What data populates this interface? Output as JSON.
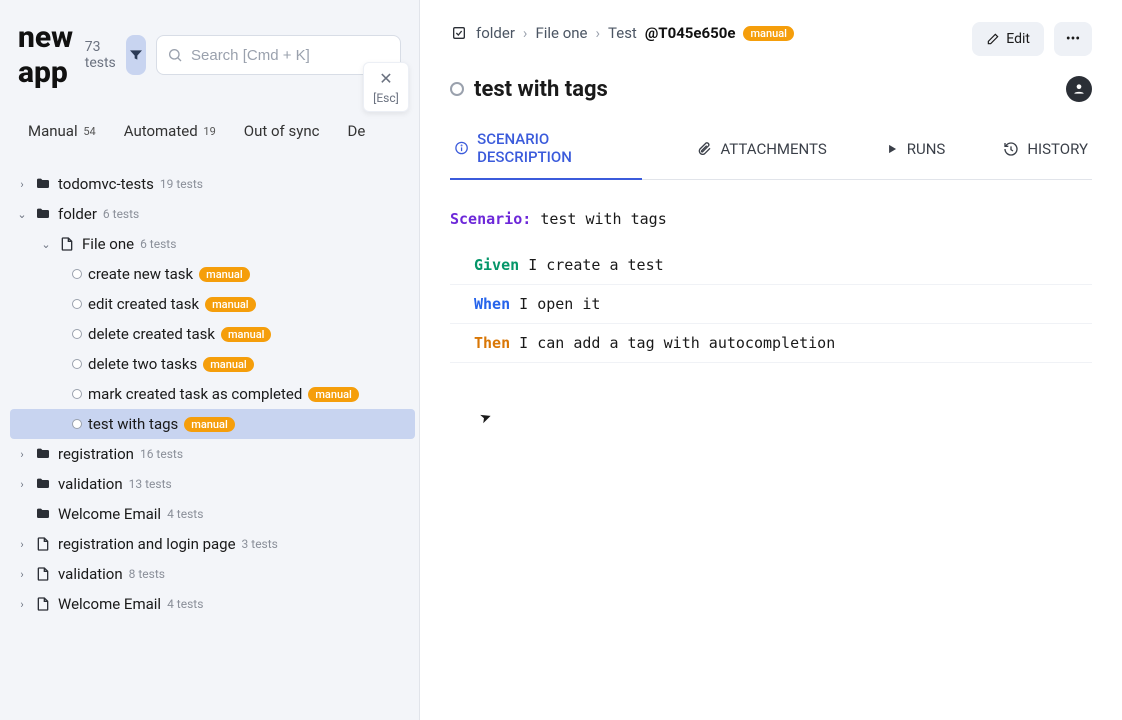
{
  "header": {
    "app_title": "new app",
    "tests_count": "73 tests",
    "search_placeholder": "Search [Cmd + K]",
    "close_esc": "[Esc]"
  },
  "filter_tabs": {
    "manual": {
      "label": "Manual",
      "count": "54"
    },
    "automated": {
      "label": "Automated",
      "count": "19"
    },
    "out_of_sync": {
      "label": "Out of sync"
    },
    "deleted": {
      "label": "De"
    }
  },
  "tree": {
    "todomvc": {
      "label": "todomvc-tests",
      "meta": "19 tests"
    },
    "folder": {
      "label": "folder",
      "meta": "6 tests"
    },
    "fileone": {
      "label": "File one",
      "meta": "6 tests"
    },
    "tests": [
      {
        "label": "create new task",
        "tag": "manual"
      },
      {
        "label": "edit created task",
        "tag": "manual"
      },
      {
        "label": "delete created task",
        "tag": "manual"
      },
      {
        "label": "delete two tasks",
        "tag": "manual"
      },
      {
        "label": "mark created task as completed",
        "tag": "manual"
      },
      {
        "label": "test with tags",
        "tag": "manual"
      }
    ],
    "registration": {
      "label": "registration",
      "meta": "16 tests"
    },
    "validation": {
      "label": "validation",
      "meta": "13 tests"
    },
    "welcome": {
      "label": "Welcome Email",
      "meta": "4 tests"
    },
    "reg_login": {
      "label": "registration and login page",
      "meta": "3 tests"
    },
    "validation2": {
      "label": "validation",
      "meta": "8 tests"
    },
    "welcome2": {
      "label": "Welcome Email",
      "meta": "4 tests"
    }
  },
  "main": {
    "breadcrumb": {
      "folder": "folder",
      "file": "File one",
      "test_prefix": "Test ",
      "test_id": "@T045e650e",
      "tag": "manual"
    },
    "edit_label": "Edit",
    "title": "test with tags",
    "tabs": {
      "scenario": "SCENARIO DESCRIPTION",
      "attachments": "ATTACHMENTS",
      "runs": "RUNS",
      "history": "HISTORY"
    },
    "scenario": {
      "keyword": "Scenario:",
      "name": "test with tags",
      "steps": [
        {
          "kw": "Given",
          "text": "I create a test"
        },
        {
          "kw": "When",
          "text": "I open it"
        },
        {
          "kw": "Then",
          "text": "I can add a tag with autocompletion"
        }
      ]
    }
  }
}
